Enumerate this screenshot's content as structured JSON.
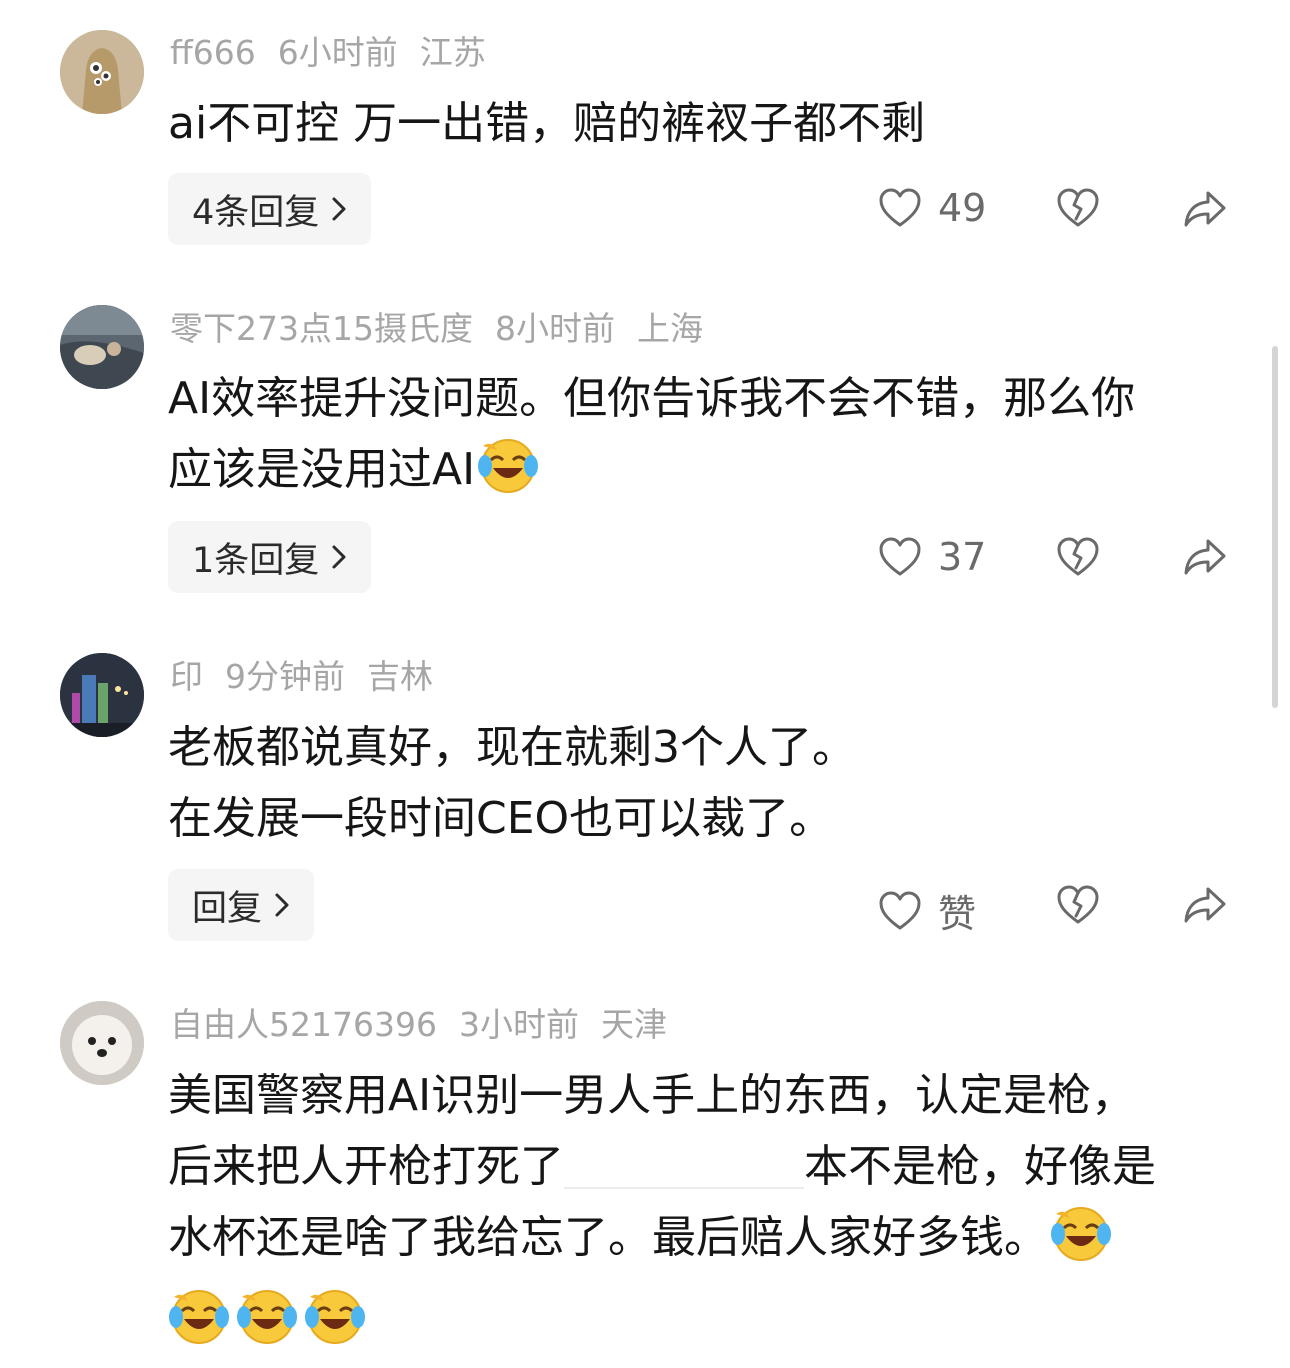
{
  "comments": [
    {
      "username": "ff666",
      "time": "6小时前",
      "location": "江苏",
      "lines": [
        "ai不可控 万一出错，赔的裤衩子都不剩"
      ],
      "reply_label": "4条回复",
      "likes": "49",
      "avatar_icon": "cartoon-avatar"
    },
    {
      "username": "零下273点15摄氏度",
      "time": "8小时前",
      "location": "上海",
      "lines": [
        "AI效率提升没问题。但你告诉我不会不错，那么你",
        "应该是没用过AI"
      ],
      "reply_label": "1条回复",
      "likes": "37",
      "avatar_icon": "photo-avatar"
    },
    {
      "username": "印",
      "time": "9分钟前",
      "location": "吉林",
      "lines": [
        "老板都说真好，现在就剩3个人了。",
        "在发展一段时间CEO也可以裁了。"
      ],
      "reply_label": "回复",
      "likes": "赞",
      "avatar_icon": "city-night-avatar"
    },
    {
      "username": "自由人52176396",
      "time": "3小时前",
      "location": "天津",
      "lines": [
        "美国警察用AI识别一男人手上的东西，认定是枪，",
        "后来把人开枪打死了",
        "本不是枪，好像是",
        "水杯还是啥了我给忘了。最后赔人家好多钱。"
      ],
      "avatar_icon": "white-dog-avatar"
    }
  ],
  "icons": {
    "like": "heart-icon",
    "dislike": "broken-heart-icon",
    "share": "share-arrow-icon",
    "emoji": "laughing-crying-emoji"
  },
  "colors": {
    "meta_text": "#a6a6a6",
    "body_text": "#161616",
    "reply_bg": "#f5f5f5",
    "icon": "#6a6a6a"
  }
}
